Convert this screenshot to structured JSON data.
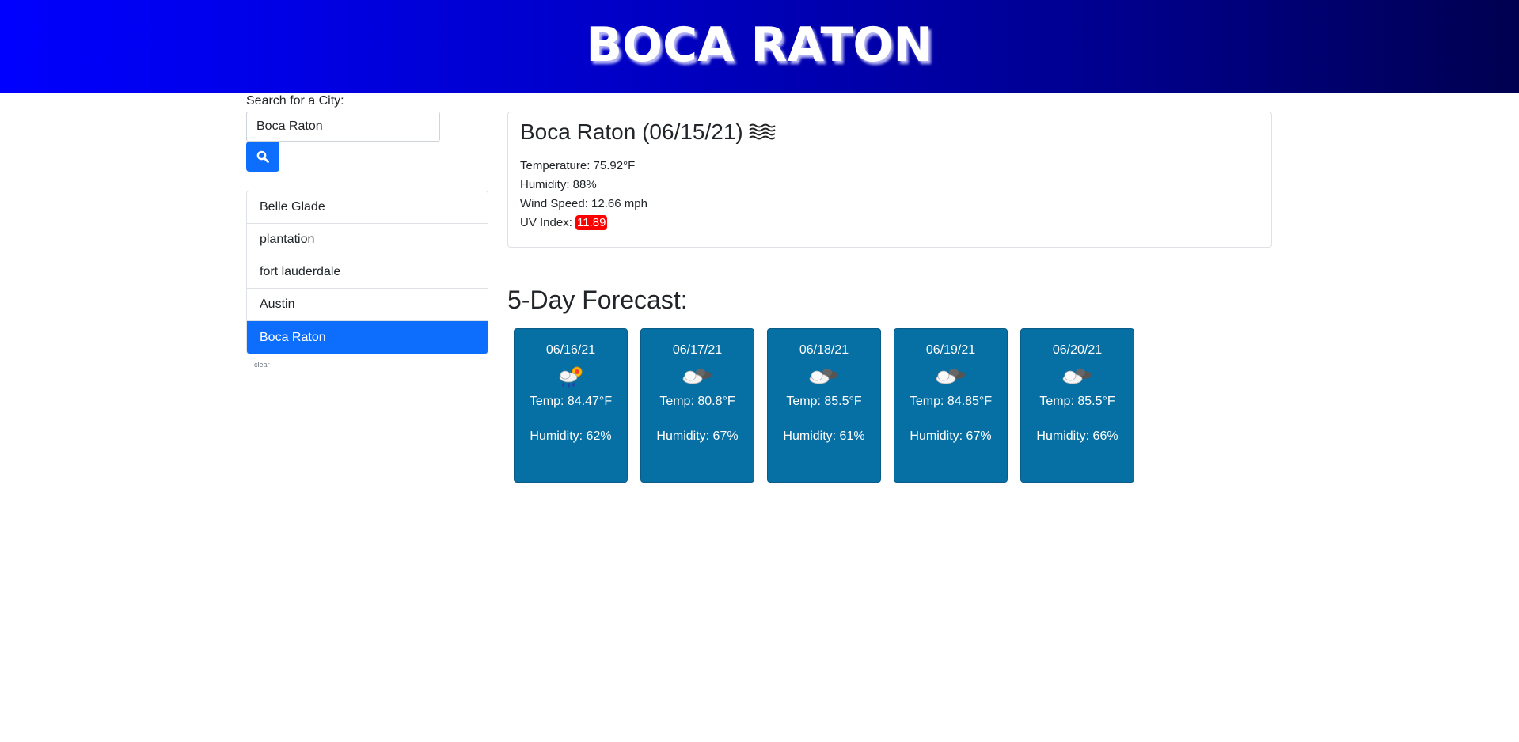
{
  "header": {
    "title": "BOCA RATON"
  },
  "search": {
    "label": "Search for a City:",
    "value": "Boca Raton",
    "button_icon": "search-icon"
  },
  "history": {
    "items": [
      {
        "label": "Belle Glade",
        "active": false
      },
      {
        "label": "plantation",
        "active": false
      },
      {
        "label": "fort lauderdale",
        "active": false
      },
      {
        "label": "Austin",
        "active": false
      },
      {
        "label": "Boca Raton",
        "active": true
      }
    ],
    "clear_label": "clear"
  },
  "current": {
    "title": "Boca Raton (06/15/21)",
    "icon": "mist-icon",
    "temperature_label": "Temperature: 75.92°F",
    "humidity_label": "Humidity: 88%",
    "wind_label": "Wind Speed: 12.66 mph",
    "uv_prefix": "UV Index: ",
    "uv_value": "11.89",
    "uv_color": "#ff0000"
  },
  "forecast": {
    "title": "5-Day Forecast:",
    "card_color": "#066fa3",
    "days": [
      {
        "date": "06/16/21",
        "icon": "rain-sun-icon",
        "temp": "Temp: 84.47°F",
        "humidity": "Humidity: 62%"
      },
      {
        "date": "06/17/21",
        "icon": "broken-clouds-icon",
        "temp": "Temp: 80.8°F",
        "humidity": "Humidity: 67%"
      },
      {
        "date": "06/18/21",
        "icon": "broken-clouds-icon",
        "temp": "Temp: 85.5°F",
        "humidity": "Humidity: 61%"
      },
      {
        "date": "06/19/21",
        "icon": "broken-clouds-icon",
        "temp": "Temp: 84.85°F",
        "humidity": "Humidity: 67%"
      },
      {
        "date": "06/20/21",
        "icon": "broken-clouds-icon",
        "temp": "Temp: 85.5°F",
        "humidity": "Humidity: 66%"
      }
    ]
  }
}
